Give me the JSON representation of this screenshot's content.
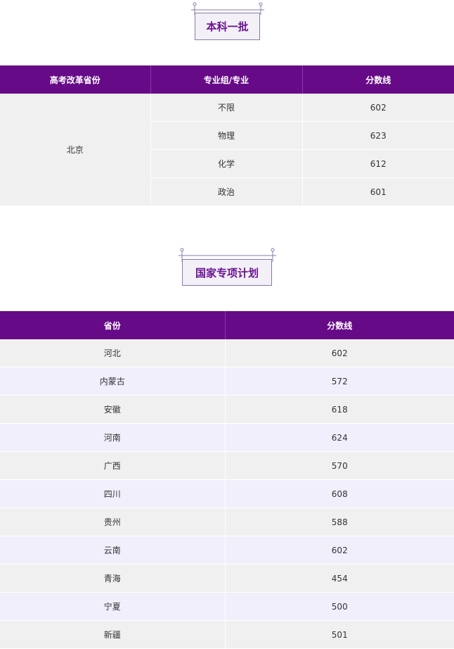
{
  "section1": {
    "title": "本科一批",
    "headers": [
      "高考改革省份",
      "专业组/专业",
      "分数线"
    ],
    "province": "北京",
    "rows": [
      {
        "major": "不限",
        "score": "602"
      },
      {
        "major": "物理",
        "score": "623"
      },
      {
        "major": "化学",
        "score": "612"
      },
      {
        "major": "政治",
        "score": "601"
      }
    ]
  },
  "section2": {
    "title": "国家专项计划",
    "headers": [
      "省份",
      "分数线"
    ],
    "rows": [
      {
        "province": "河北",
        "score": "602"
      },
      {
        "province": "内蒙古",
        "score": "572"
      },
      {
        "province": "安徽",
        "score": "618"
      },
      {
        "province": "河南",
        "score": "624"
      },
      {
        "province": "广西",
        "score": "570"
      },
      {
        "province": "四川",
        "score": "608"
      },
      {
        "province": "贵州",
        "score": "588"
      },
      {
        "province": "云南",
        "score": "602"
      },
      {
        "province": "青海",
        "score": "454"
      },
      {
        "province": "宁夏",
        "score": "500"
      },
      {
        "province": "新疆",
        "score": "501"
      }
    ]
  },
  "colors": {
    "header_bg": "#660a87",
    "title_text": "#6a1490",
    "row_gray": "#f0f0f0",
    "row_lavender": "#f1effc"
  }
}
